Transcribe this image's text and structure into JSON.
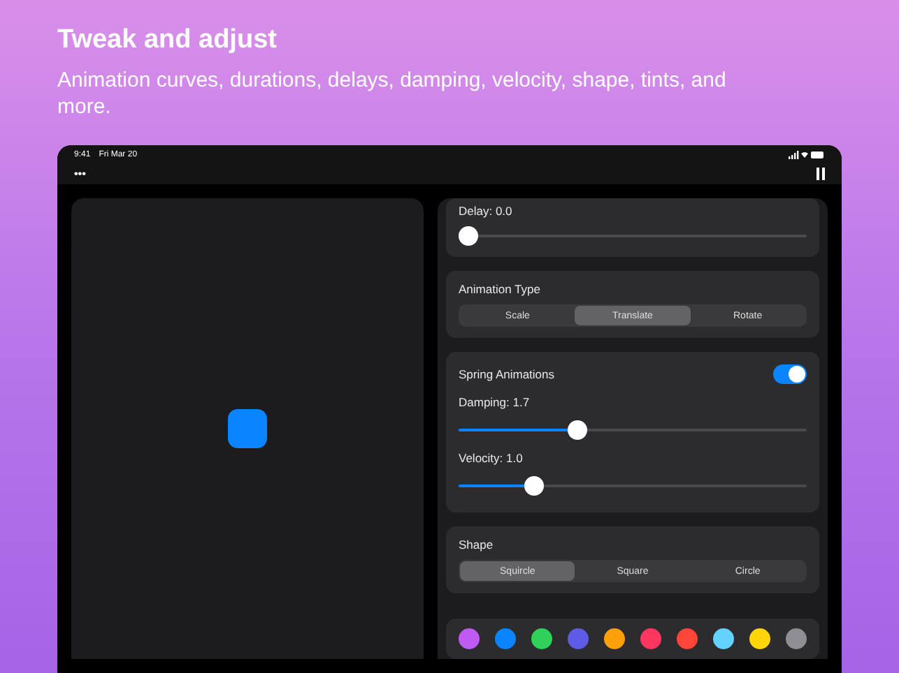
{
  "header": {
    "title": "Tweak and adjust",
    "subtitle": "Animation curves, durations, delays, damping, velocity, shape, tints, and more."
  },
  "status_bar": {
    "time": "9:41",
    "date": "Fri Mar 20"
  },
  "toolbar": {
    "more": "•••"
  },
  "delay": {
    "label": "Delay: 0.0",
    "level": 0
  },
  "animation_type": {
    "title": "Animation Type",
    "segments": [
      {
        "label": "Scale",
        "selected": false
      },
      {
        "label": "Translate",
        "selected": true
      },
      {
        "label": "Rotate",
        "selected": false
      }
    ]
  },
  "spring": {
    "title": "Spring Animations",
    "on": true,
    "sliders": [
      {
        "label": "Damping: 1.7",
        "level": 0.33
      },
      {
        "label": "Velocity: 1.0",
        "level": 0.2
      }
    ]
  },
  "shape": {
    "title": "Shape",
    "segments": [
      {
        "label": "Squircle",
        "selected": true
      },
      {
        "label": "Square",
        "selected": false
      },
      {
        "label": "Circle",
        "selected": false
      }
    ]
  },
  "tints": [
    {
      "color": "#bf5af2"
    },
    {
      "color": "#0a84ff"
    },
    {
      "color": "#30d158"
    },
    {
      "color": "#5e5ce6"
    },
    {
      "color": "#ff9f0a"
    },
    {
      "color": "#ff375f"
    },
    {
      "color": "#ff453a"
    },
    {
      "color": "#64d2ff"
    },
    {
      "color": "#ffd60a"
    },
    {
      "color": "#8e8e93"
    }
  ]
}
